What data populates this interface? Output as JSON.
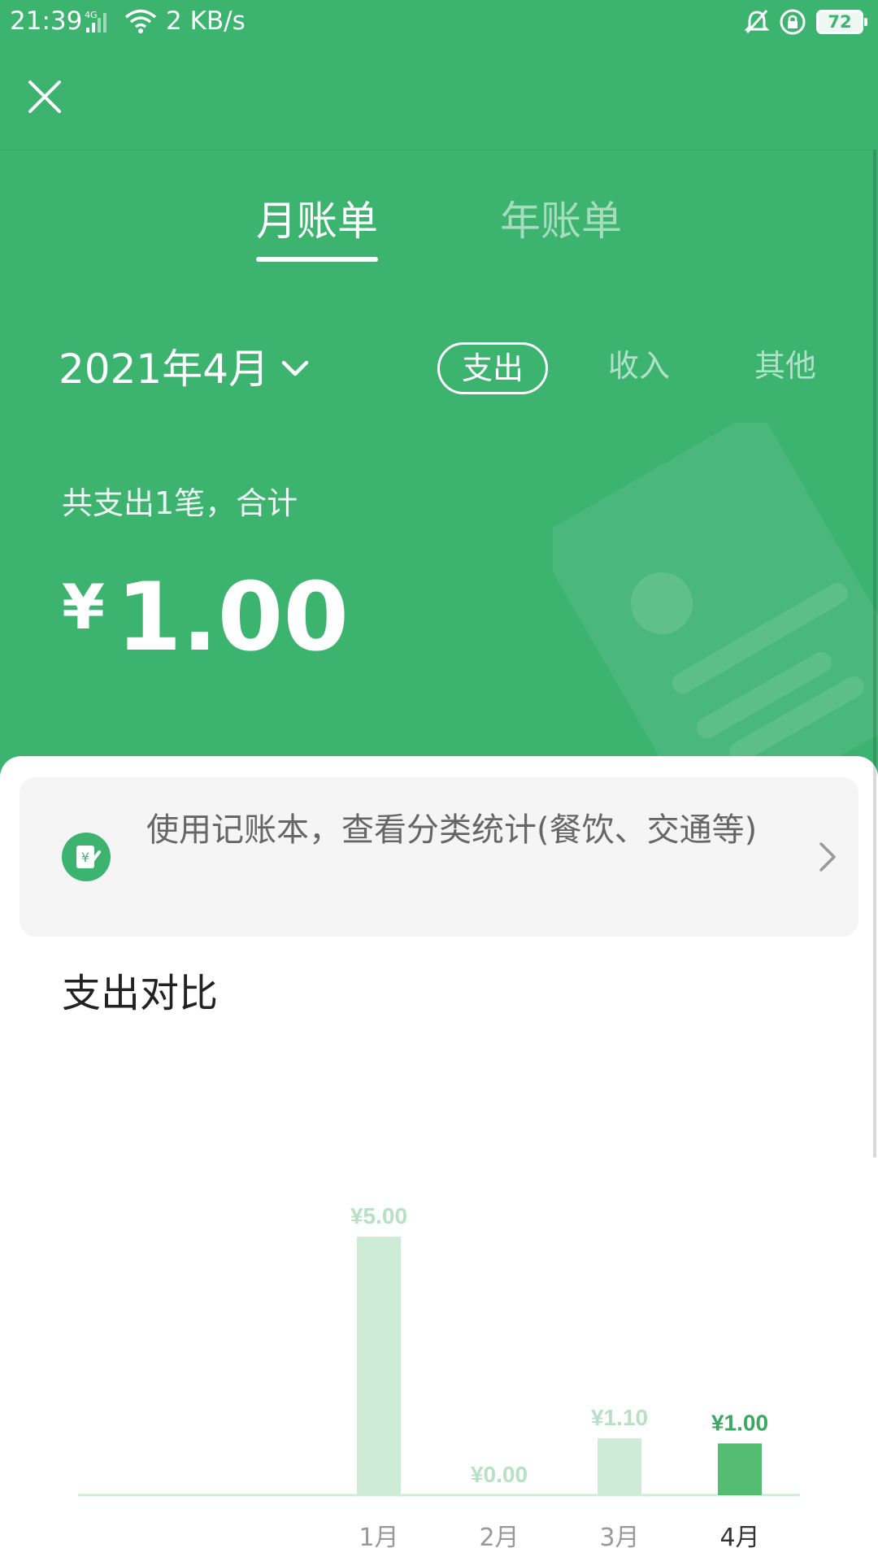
{
  "status_bar": {
    "time": "21:39",
    "network": "4G",
    "speed": "2 KB/s",
    "battery": "72",
    "icons": [
      "signal-icon",
      "wifi-icon",
      "alarm-off-icon",
      "rotation-lock-icon",
      "battery-icon"
    ]
  },
  "header": {
    "close_icon": "close-icon"
  },
  "tabs": [
    {
      "label": "月账单",
      "active": true
    },
    {
      "label": "年账单",
      "active": false
    }
  ],
  "period": {
    "label": "2021年4月",
    "icon": "chevron-down-icon"
  },
  "filters": [
    {
      "label": "支出",
      "active": true
    },
    {
      "label": "收入",
      "active": false
    },
    {
      "label": "其他",
      "active": false
    }
  ],
  "summary": {
    "text": "共支出1笔，合计",
    "currency": "¥",
    "amount": "1.00"
  },
  "promo": {
    "icon": "ledger-icon",
    "text": "使用记账本，查看分类统计(餐饮、交通等)",
    "arrow": "chevron-right-icon"
  },
  "section": {
    "title": "支出对比"
  },
  "colors": {
    "brand_green": "#3db370",
    "bar_active": "#55bd72",
    "bar_inactive": "#cdebd6",
    "label_inactive": "#b8e0c4",
    "label_active": "#3aa860"
  },
  "chart_data": {
    "type": "bar",
    "title": "支出对比",
    "categories": [
      "1月",
      "2月",
      "3月",
      "4月"
    ],
    "values": [
      5.0,
      0.0,
      1.1,
      1.0
    ],
    "value_labels": [
      "¥5.00",
      "¥0.00",
      "¥1.10",
      "¥1.00"
    ],
    "highlight_index": 3,
    "grid": false,
    "legend": "none"
  }
}
